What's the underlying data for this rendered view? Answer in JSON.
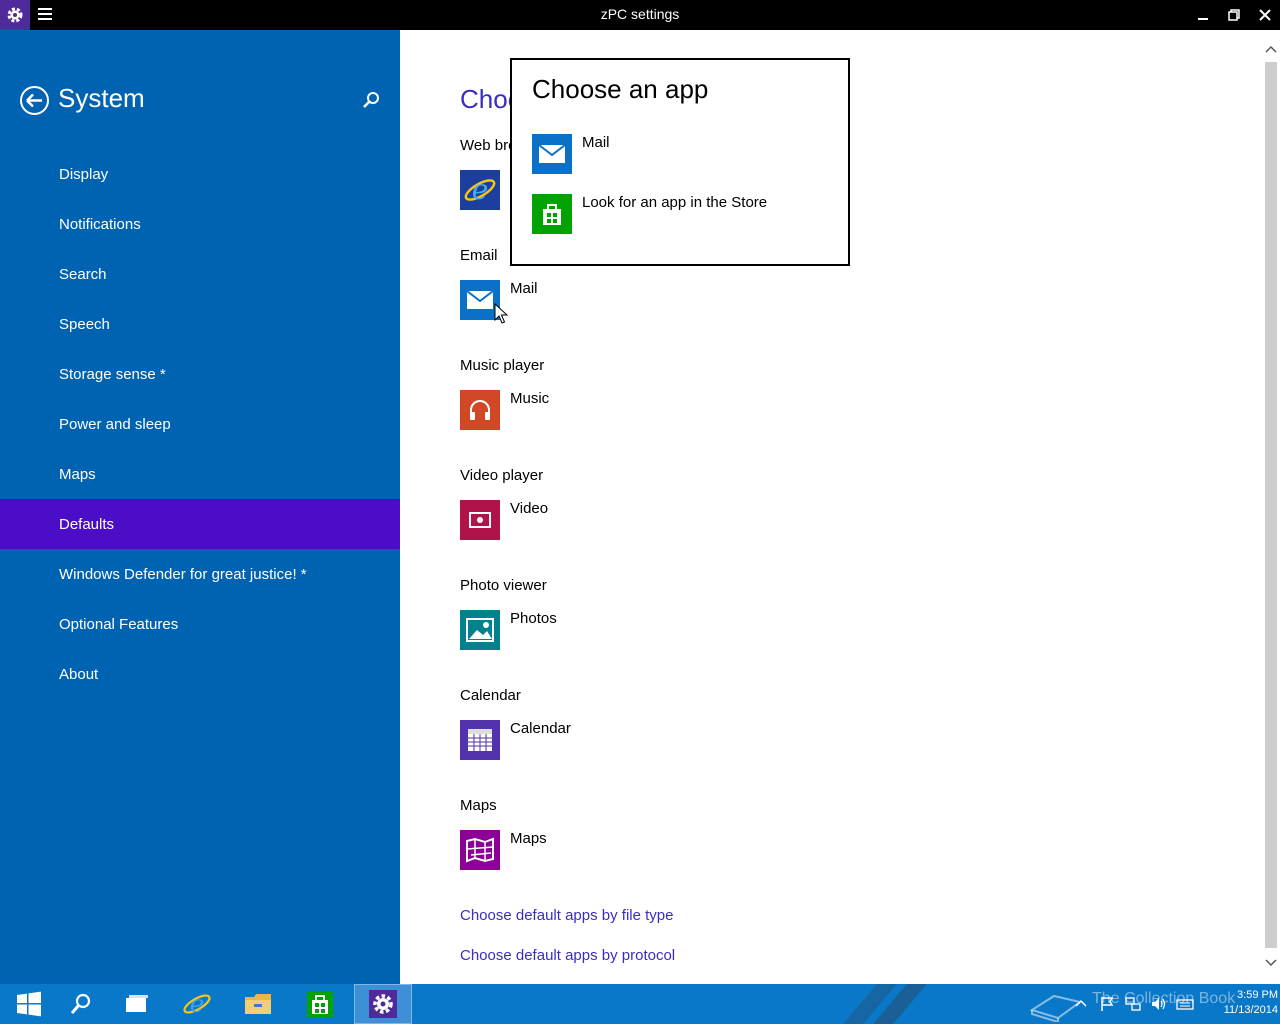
{
  "window": {
    "title": "zPC settings"
  },
  "sidebar": {
    "title": "System",
    "items": [
      {
        "label": "Display"
      },
      {
        "label": "Notifications"
      },
      {
        "label": "Search"
      },
      {
        "label": "Speech"
      },
      {
        "label": "Storage sense *"
      },
      {
        "label": "Power and sleep"
      },
      {
        "label": "Maps"
      },
      {
        "label": "Defaults",
        "selected": true
      },
      {
        "label": "Windows Defender for great justice! *"
      },
      {
        "label": "Optional Features"
      },
      {
        "label": "About"
      }
    ]
  },
  "main": {
    "heading": "Choo",
    "sections": [
      {
        "label": "Web bro",
        "app": "",
        "icon": "internet-explorer-icon"
      },
      {
        "label": "Email",
        "app": "Mail",
        "icon": "mail-icon"
      },
      {
        "label": "Music player",
        "app": "Music",
        "icon": "headphones-icon"
      },
      {
        "label": "Video player",
        "app": "Video",
        "icon": "video-icon"
      },
      {
        "label": "Photo viewer",
        "app": "Photos",
        "icon": "photos-icon"
      },
      {
        "label": "Calendar",
        "app": "Calendar",
        "icon": "calendar-icon"
      },
      {
        "label": "Maps",
        "app": "Maps",
        "icon": "maps-icon"
      }
    ],
    "links": [
      {
        "label": "Choose default apps by file type"
      },
      {
        "label": "Choose default apps by protocol"
      }
    ]
  },
  "flyout": {
    "title": "Choose an app",
    "items": [
      {
        "label": "Mail",
        "icon": "mail-icon"
      },
      {
        "label": "Look for an app in the Store",
        "icon": "store-icon"
      }
    ]
  },
  "taskbar": {
    "watermark": "The Collection Book",
    "time": "3:59 PM",
    "date": "11/13/2014"
  },
  "colors": {
    "sidebar": "#0063b1",
    "selected": "#4b0ec6",
    "link": "#3a2ec2",
    "mail": "#0a70c8",
    "music": "#d24726",
    "video": "#b0134a",
    "photos": "#00828c",
    "calendar": "#5133ab",
    "maps": "#8c0095",
    "store": "#00a300"
  }
}
